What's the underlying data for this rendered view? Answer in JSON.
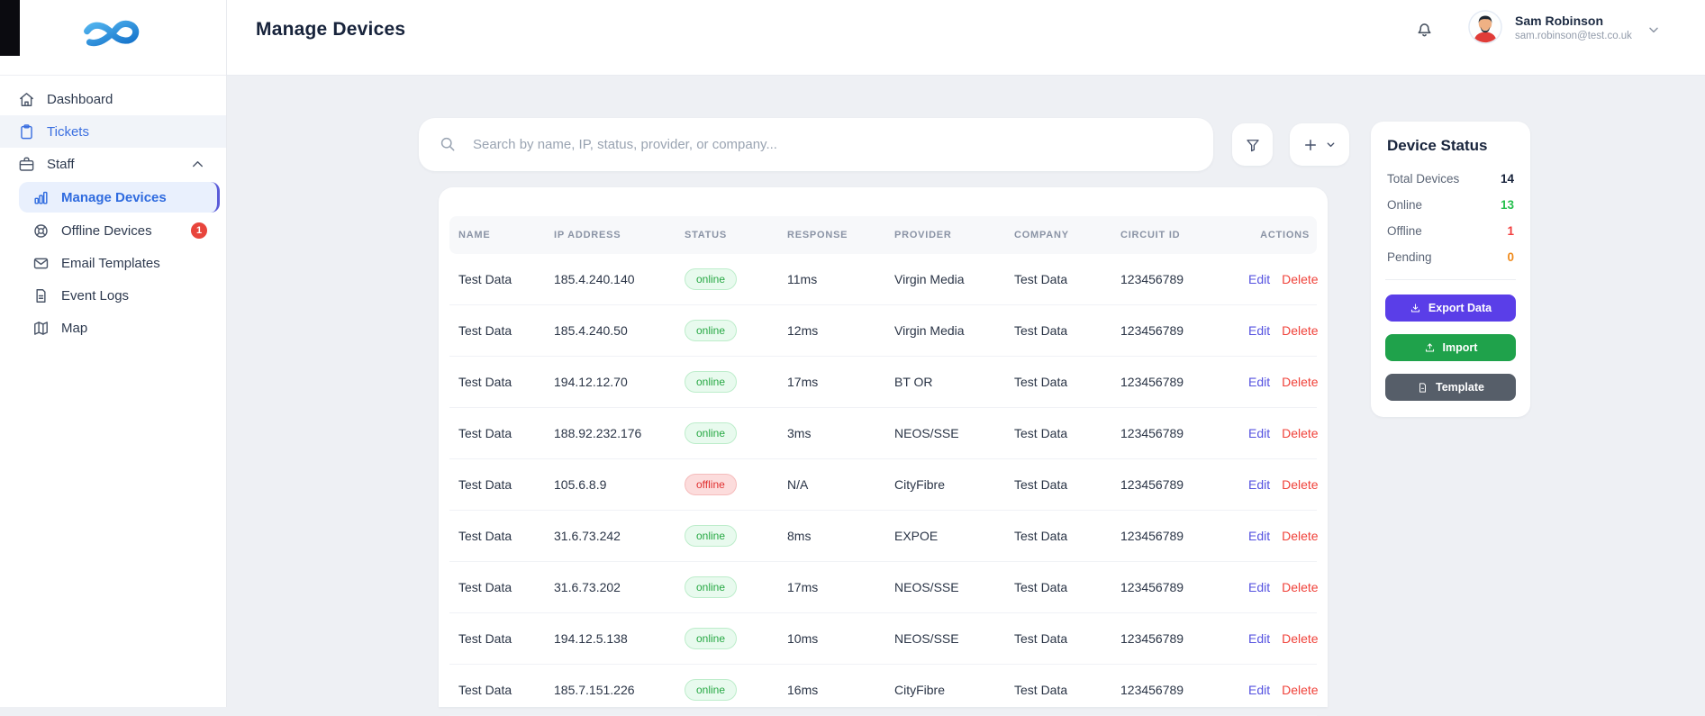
{
  "sidebar": {
    "items": [
      {
        "id": "dashboard",
        "label": "Dashboard",
        "icon": "home-icon",
        "indent": 0
      },
      {
        "id": "tickets",
        "label": "Tickets",
        "icon": "clipboard-icon",
        "indent": 0,
        "state": "selected-row"
      },
      {
        "id": "staff",
        "label": "Staff",
        "icon": "briefcase-icon",
        "indent": 0,
        "chevron": "up"
      },
      {
        "id": "manage-devices",
        "label": "Manage Devices",
        "icon": "bar-chart-icon",
        "indent": 1,
        "state": "active"
      },
      {
        "id": "offline-devices",
        "label": "Offline Devices",
        "icon": "lifebuoy-icon",
        "indent": 1,
        "badge": "1"
      },
      {
        "id": "email-templates",
        "label": "Email Templates",
        "icon": "mail-icon",
        "indent": 1
      },
      {
        "id": "event-logs",
        "label": "Event Logs",
        "icon": "file-icon",
        "indent": 1
      },
      {
        "id": "map",
        "label": "Map",
        "icon": "map-icon",
        "indent": 1
      }
    ]
  },
  "header": {
    "title": "Manage Devices",
    "user": {
      "name": "Sam Robinson",
      "email": "sam.robinson@test.co.uk"
    }
  },
  "toolbar": {
    "search_placeholder": "Search by name, IP, status, provider, or company..."
  },
  "table": {
    "columns": [
      "NAME",
      "IP ADDRESS",
      "STATUS",
      "RESPONSE",
      "PROVIDER",
      "COMPANY",
      "CIRCUIT ID",
      "ACTIONS"
    ],
    "edit_label": "Edit",
    "delete_label": "Delete",
    "rows": [
      {
        "name": "Test Data",
        "ip": "185.4.240.140",
        "status": "online",
        "response": "11ms",
        "provider": "Virgin Media",
        "company": "Test Data",
        "circuit_id": "123456789"
      },
      {
        "name": "Test Data",
        "ip": "185.4.240.50",
        "status": "online",
        "response": "12ms",
        "provider": "Virgin Media",
        "company": "Test Data",
        "circuit_id": "123456789"
      },
      {
        "name": "Test Data",
        "ip": "194.12.12.70",
        "status": "online",
        "response": "17ms",
        "provider": "BT OR",
        "company": "Test Data",
        "circuit_id": "123456789"
      },
      {
        "name": "Test Data",
        "ip": "188.92.232.176",
        "status": "online",
        "response": "3ms",
        "provider": "NEOS/SSE",
        "company": "Test Data",
        "circuit_id": "123456789"
      },
      {
        "name": "Test Data",
        "ip": "105.6.8.9",
        "status": "offline",
        "response": "N/A",
        "provider": "CityFibre",
        "company": "Test Data",
        "circuit_id": "123456789"
      },
      {
        "name": "Test Data",
        "ip": "31.6.73.242",
        "status": "online",
        "response": "8ms",
        "provider": "EXPOE",
        "company": "Test Data",
        "circuit_id": "123456789"
      },
      {
        "name": "Test Data",
        "ip": "31.6.73.202",
        "status": "online",
        "response": "17ms",
        "provider": "NEOS/SSE",
        "company": "Test Data",
        "circuit_id": "123456789"
      },
      {
        "name": "Test Data",
        "ip": "194.12.5.138",
        "status": "online",
        "response": "10ms",
        "provider": "NEOS/SSE",
        "company": "Test Data",
        "circuit_id": "123456789"
      },
      {
        "name": "Test Data",
        "ip": "185.7.151.226",
        "status": "online",
        "response": "16ms",
        "provider": "CityFibre",
        "company": "Test Data",
        "circuit_id": "123456789"
      }
    ]
  },
  "device_status": {
    "title": "Device Status",
    "stats": [
      {
        "label": "Total Devices",
        "value": "14",
        "color": "#17233b"
      },
      {
        "label": "Online",
        "value": "13",
        "color": "#27c04f"
      },
      {
        "label": "Offline",
        "value": "1",
        "color": "#f23e3e"
      },
      {
        "label": "Pending",
        "value": "0",
        "color": "#ef8b1d"
      }
    ],
    "buttons": [
      {
        "id": "export-data",
        "label": "Export Data",
        "icon": "download-icon",
        "color": "#5a3ee8"
      },
      {
        "id": "import",
        "label": "Import",
        "icon": "upload-icon",
        "color": "#1fa24b"
      },
      {
        "id": "template",
        "label": "Template",
        "icon": "document-icon",
        "color": "#565e69"
      }
    ]
  },
  "colors": {
    "status_online_text": "#27a844",
    "status_online_bg": "#e8faee",
    "status_offline_text": "#e03131",
    "status_offline_bg": "#fcdcdc",
    "badge_red": "#e8453c",
    "active_nav_blue": "#2f6bdf"
  }
}
